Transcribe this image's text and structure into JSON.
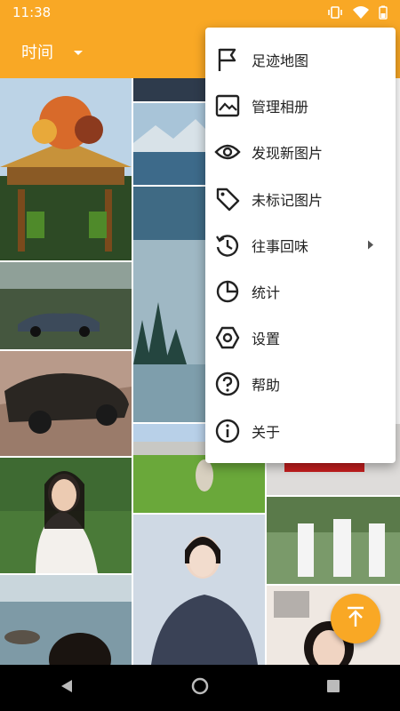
{
  "status_bar": {
    "time": "11:38"
  },
  "app_bar": {
    "title": "时间"
  },
  "menu": {
    "items": [
      {
        "label": "足迹地图",
        "icon": "flag-icon"
      },
      {
        "label": "管理相册",
        "icon": "image-icon"
      },
      {
        "label": "发现新图片",
        "icon": "eye-icon"
      },
      {
        "label": "未标记图片",
        "icon": "tag-icon"
      },
      {
        "label": "往事回味",
        "icon": "history-icon",
        "has_submenu": true
      },
      {
        "label": "统计",
        "icon": "pie-chart-icon"
      },
      {
        "label": "设置",
        "icon": "settings-icon"
      },
      {
        "label": "帮助",
        "icon": "help-icon"
      },
      {
        "label": "关于",
        "icon": "info-icon"
      }
    ]
  },
  "colors": {
    "accent": "#f9a825",
    "nav_bg": "#000000"
  }
}
